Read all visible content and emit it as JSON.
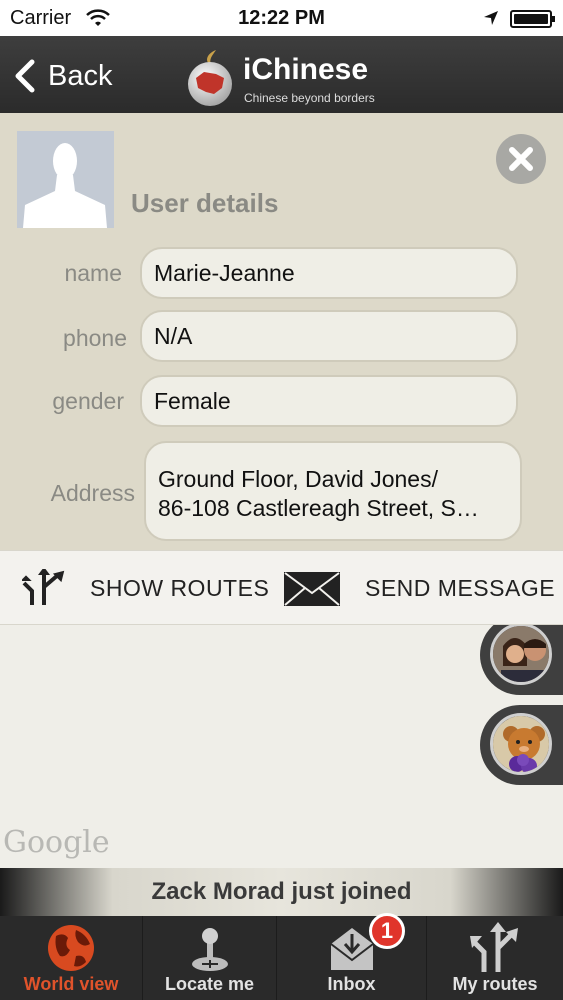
{
  "status_bar": {
    "carrier": "Carrier",
    "time": "12:22 PM",
    "battery_level": 1.0
  },
  "nav": {
    "back_label": "Back",
    "app_name": "iChinese",
    "tagline": "Chinese  beyond borders"
  },
  "user_details": {
    "title": "User details",
    "fields": [
      {
        "label": "name",
        "value": "Marie-Jeanne"
      },
      {
        "label": "phone",
        "value": "N/A"
      },
      {
        "label": "gender",
        "value": "Female"
      },
      {
        "label": "Address",
        "value_line1": "Ground Floor, David Jones/",
        "value_line2": "86-108 Castlereagh Street, S…"
      }
    ]
  },
  "actions": {
    "show_routes": "SHOW ROUTES",
    "send_message": "SEND MESSAGE"
  },
  "map": {
    "attribution": "Google"
  },
  "notification": "Zack Morad just joined",
  "tabs": [
    {
      "label": "World view",
      "icon": "globe-icon",
      "active": true
    },
    {
      "label": "Locate me",
      "icon": "joystick-icon",
      "active": false
    },
    {
      "label": "Inbox",
      "icon": "inbox-icon",
      "active": false,
      "badge": "1"
    },
    {
      "label": "My routes",
      "icon": "routes-icon",
      "active": false
    }
  ],
  "colors": {
    "accent": "#e0532b",
    "badge": "#e0352b",
    "panel": "#ddd9c9",
    "navbar": "#333333"
  }
}
